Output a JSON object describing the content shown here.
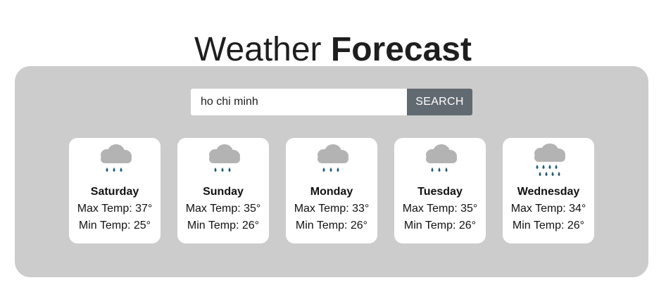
{
  "header": {
    "title_light": "Weather",
    "title_bold": "Forecast"
  },
  "search": {
    "value": "ho chi minh",
    "button_label": "SEARCH"
  },
  "colors": {
    "panel": "#cccccc",
    "button": "#616971",
    "cloud": "#b3b3b3",
    "rain": "#1f5a74"
  },
  "forecast": [
    {
      "day": "Saturday",
      "max": "Max Temp: 37°",
      "min": "Min Temp: 25°",
      "icon": "rain-cloud-icon"
    },
    {
      "day": "Sunday",
      "max": "Max Temp: 35°",
      "min": "Min Temp: 26°",
      "icon": "rain-cloud-icon"
    },
    {
      "day": "Monday",
      "max": "Max Temp: 33°",
      "min": "Min Temp: 26°",
      "icon": "rain-cloud-icon"
    },
    {
      "day": "Tuesday",
      "max": "Max Temp: 35°",
      "min": "Min Temp: 26°",
      "icon": "rain-cloud-icon"
    },
    {
      "day": "Wednesday",
      "max": "Max Temp: 34°",
      "min": "Min Temp: 26°",
      "icon": "heavy-rain-cloud-icon"
    }
  ]
}
